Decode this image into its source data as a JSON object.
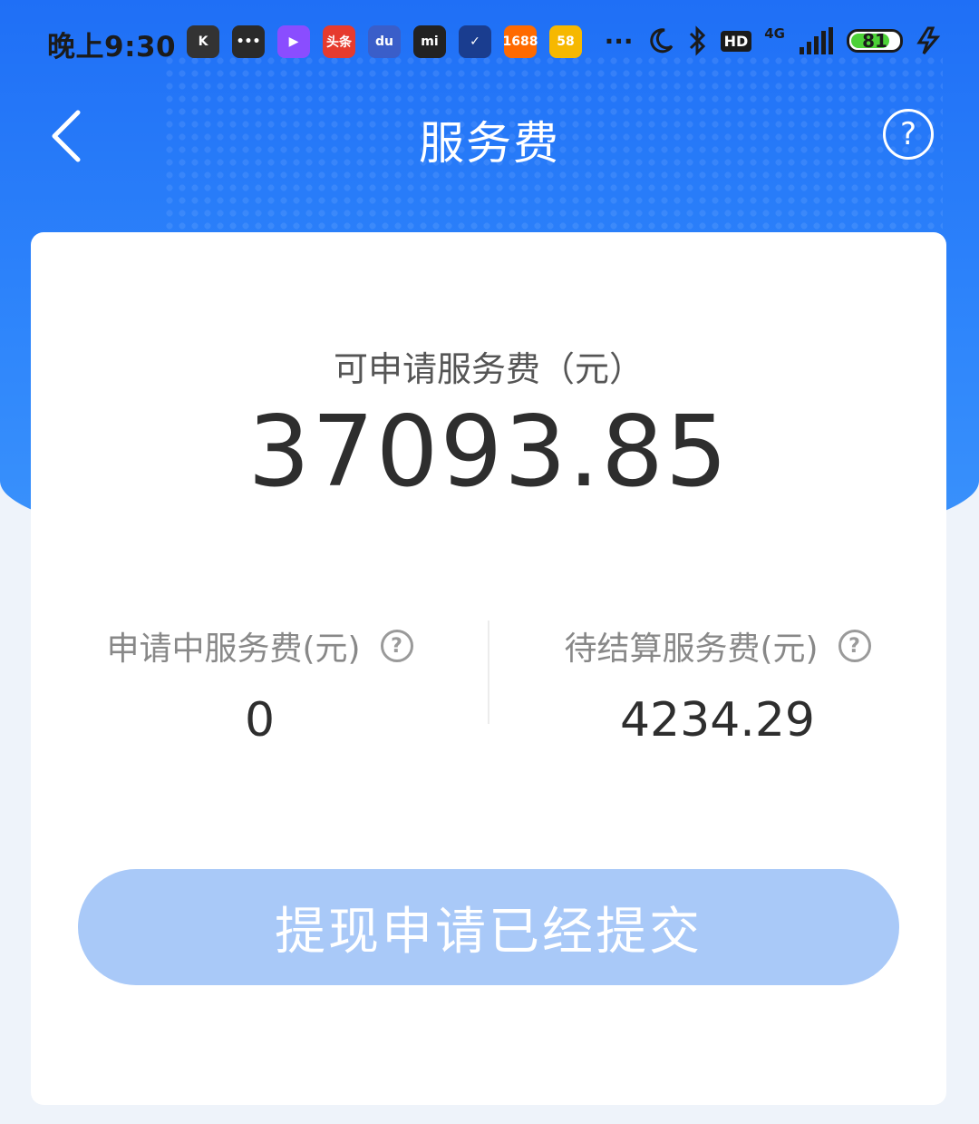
{
  "status_bar": {
    "time": "晚上9:30",
    "app_icons": [
      {
        "name": "k-app-icon",
        "label": "K",
        "color": "#333333"
      },
      {
        "name": "message-icon",
        "label": "•••",
        "color": "#2a2a2a"
      },
      {
        "name": "video-play-icon",
        "label": "▶",
        "color": "#8a4dff"
      },
      {
        "name": "toutiao-icon",
        "label": "头条",
        "color": "#e63b2e"
      },
      {
        "name": "baidu-icon",
        "label": "du",
        "color": "#3a5ec9"
      },
      {
        "name": "mi-icon",
        "label": "mi",
        "color": "#222222"
      },
      {
        "name": "check-icon",
        "label": "✓",
        "color": "#1a3d8f"
      },
      {
        "name": "1688-icon",
        "label": "1688",
        "color": "#ff6a00"
      },
      {
        "name": "58-icon",
        "label": "58",
        "color": "#f6b800"
      }
    ],
    "more": "···",
    "network": "4G",
    "battery": 81
  },
  "header": {
    "title": "服务费",
    "help_symbol": "?"
  },
  "summary": {
    "label": "可申请服务费（元）",
    "amount": "37093.85"
  },
  "stats": [
    {
      "label": "申请中服务费(元)",
      "value": "0"
    },
    {
      "label": "待结算服务费(元)",
      "value": "4234.29"
    }
  ],
  "action": {
    "button_label": "提现申请已经提交"
  }
}
